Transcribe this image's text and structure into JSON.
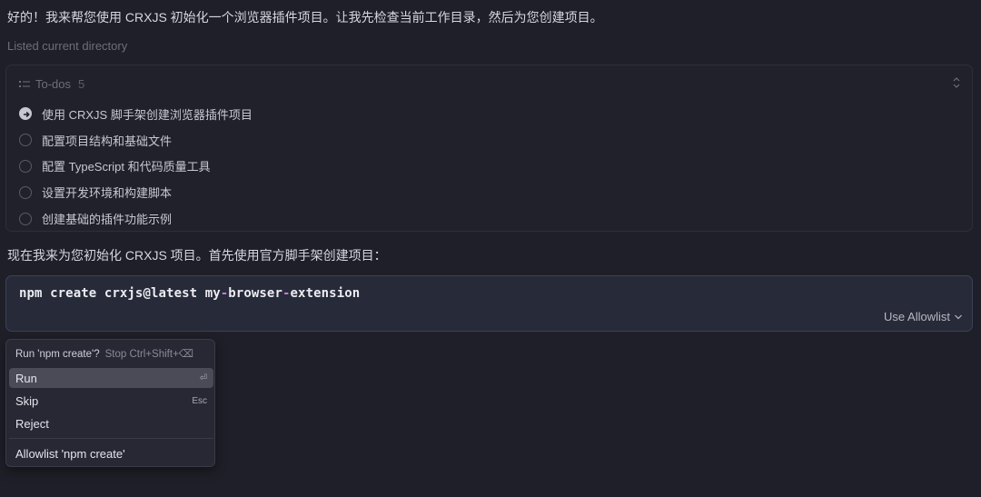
{
  "chat": {
    "intro": "好的！我来帮您使用 CRXJS 初始化一个浏览器插件项目。让我先检查当前工作目录，然后为您创建项目。",
    "listed_status": "Listed current directory",
    "next_message": "现在我来为您初始化 CRXJS 项目。首先使用官方脚手架创建项目："
  },
  "todos": {
    "header_label": "To-dos",
    "count": "5",
    "items": [
      {
        "label": "使用 CRXJS 脚手架创建浏览器插件项目",
        "status": "in-progress"
      },
      {
        "label": "配置项目结构和基础文件",
        "status": "pending"
      },
      {
        "label": "配置 TypeScript 和代码质量工具",
        "status": "pending"
      },
      {
        "label": "设置开发环境和构建脚本",
        "status": "pending"
      },
      {
        "label": "创建基础的插件功能示例",
        "status": "pending"
      }
    ]
  },
  "command": {
    "part1": "npm create crxjs@latest my",
    "sep1": "-",
    "part2": "browser",
    "sep2": "-",
    "part3": "extension",
    "allowlist_label": "Use Allowlist"
  },
  "menu": {
    "title": "Run 'npm create'?",
    "title_hint": "Stop Ctrl+Shift+⌫",
    "run_label": "Run",
    "run_key": "⏎",
    "skip_label": "Skip",
    "skip_key": "Esc",
    "reject_label": "Reject",
    "allowlist_label": "Allowlist 'npm create'"
  },
  "icons": {
    "todo_list": "list-icon",
    "collapse": "chevron-up-down-icon",
    "active_item": "arrow-right-circle-icon",
    "dropdown": "chevron-down-icon"
  }
}
